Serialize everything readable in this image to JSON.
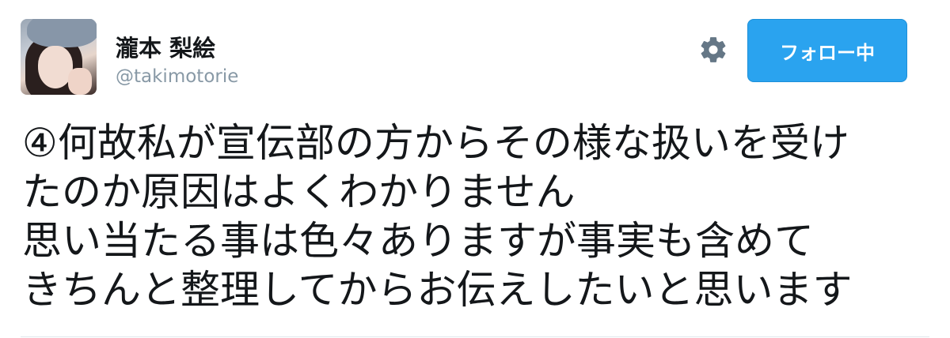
{
  "user": {
    "display_name": "瀧本 梨絵",
    "handle": "@takimotorie",
    "avatar": "profile-photo"
  },
  "actions": {
    "settings_icon": "gear-icon",
    "follow_label": "フォロー中"
  },
  "tweet": {
    "lines": [
      "④何故私が宣伝部の方からその様な扱いを受け",
      "たのか原因はよくわかりません",
      "思い当たる事は色々ありますが事実も含めて",
      "きちんと整理してからお伝えしたいと思います"
    ]
  },
  "colors": {
    "accent": "#2aa3ef",
    "text": "#14171a",
    "muted": "#8899a6",
    "icon": "#657786"
  }
}
